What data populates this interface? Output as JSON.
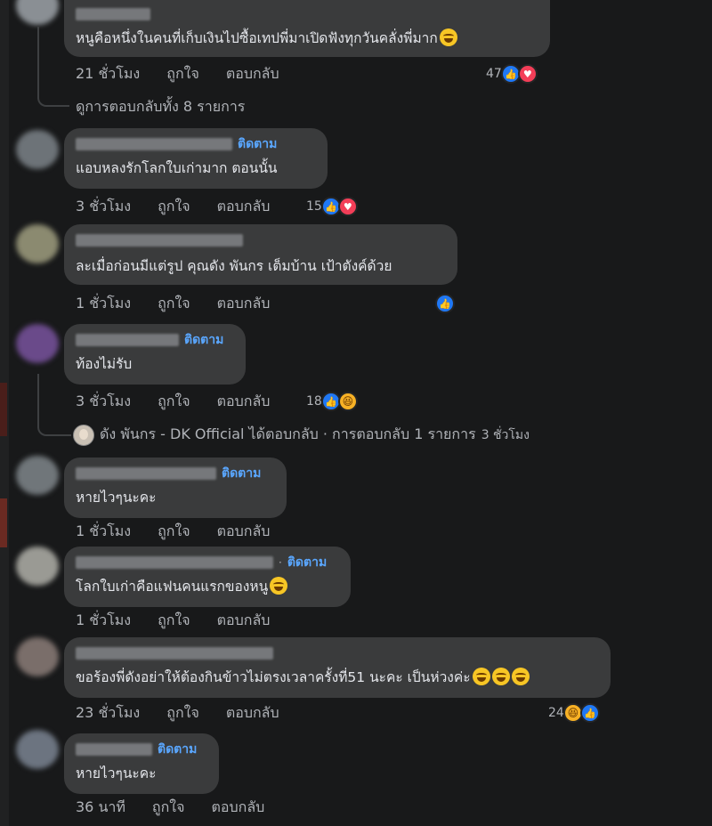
{
  "actions": {
    "like": "ถูกใจ",
    "reply": "ตอบกลับ"
  },
  "follow_label": "ติดตาม",
  "comments": [
    {
      "text": "หนูคือหนึ่งในคนที่เก็บเงินไปซื้อเทปพี่มาเปิดฟังทุกวันคลั่งพี่มาก",
      "time": "21 ชั่วโมง",
      "reaction_count": "47",
      "view_replies": "ดูการตอบกลับทั้ง 8 รายการ"
    },
    {
      "text": "แอบหลงรักโลกใบเก่ามาก ตอนนั้น",
      "time": "3 ชั่วโมง",
      "reaction_count": "15"
    },
    {
      "text": "ละเมื่อก่อนมีแต่รูป คุณดัง พันกร เต็มบ้าน เป้าตังค์ด้วย",
      "time": "1 ชั่วโมง"
    },
    {
      "text": "ท้องไม่รับ",
      "time": "3 ชั่วโมง",
      "reaction_count": "18",
      "reply_summary": {
        "author": "ดัง พันกร - DK Official",
        "text": "ได้ตอบกลับ · การตอบกลับ 1 รายการ",
        "time": "3 ชั่วโมง"
      }
    },
    {
      "text": "หายไวๆนะคะ",
      "time": "1 ชั่วโมง"
    },
    {
      "text": "โลกใบเก่าคือแฟนคนแรกของหนู",
      "time": "1 ชั่วโมง"
    },
    {
      "text": "ขอร้องพี่ดังอย่าให้ต้องกินข้าวไม่ตรงเวลาครั้งที่51 นะคะ เป็นห่วงค่ะ",
      "time": "23 ชั่วโมง",
      "reaction_count": "24"
    },
    {
      "text": "หายไวๆนะคะ",
      "time": "36 นาที"
    }
  ],
  "colors": {
    "background": "#18191a",
    "bubble": "#3a3b3c",
    "link": "#5aa7ff",
    "like": "#2078f4",
    "love": "#f33e58",
    "haha": "#f7b125"
  },
  "icons": [
    "like-reaction-icon",
    "love-reaction-icon",
    "haha-reaction-icon",
    "grinning-emoji-icon",
    "sweat-smile-emoji-icon",
    "tears-of-joy-emoji-icon"
  ]
}
